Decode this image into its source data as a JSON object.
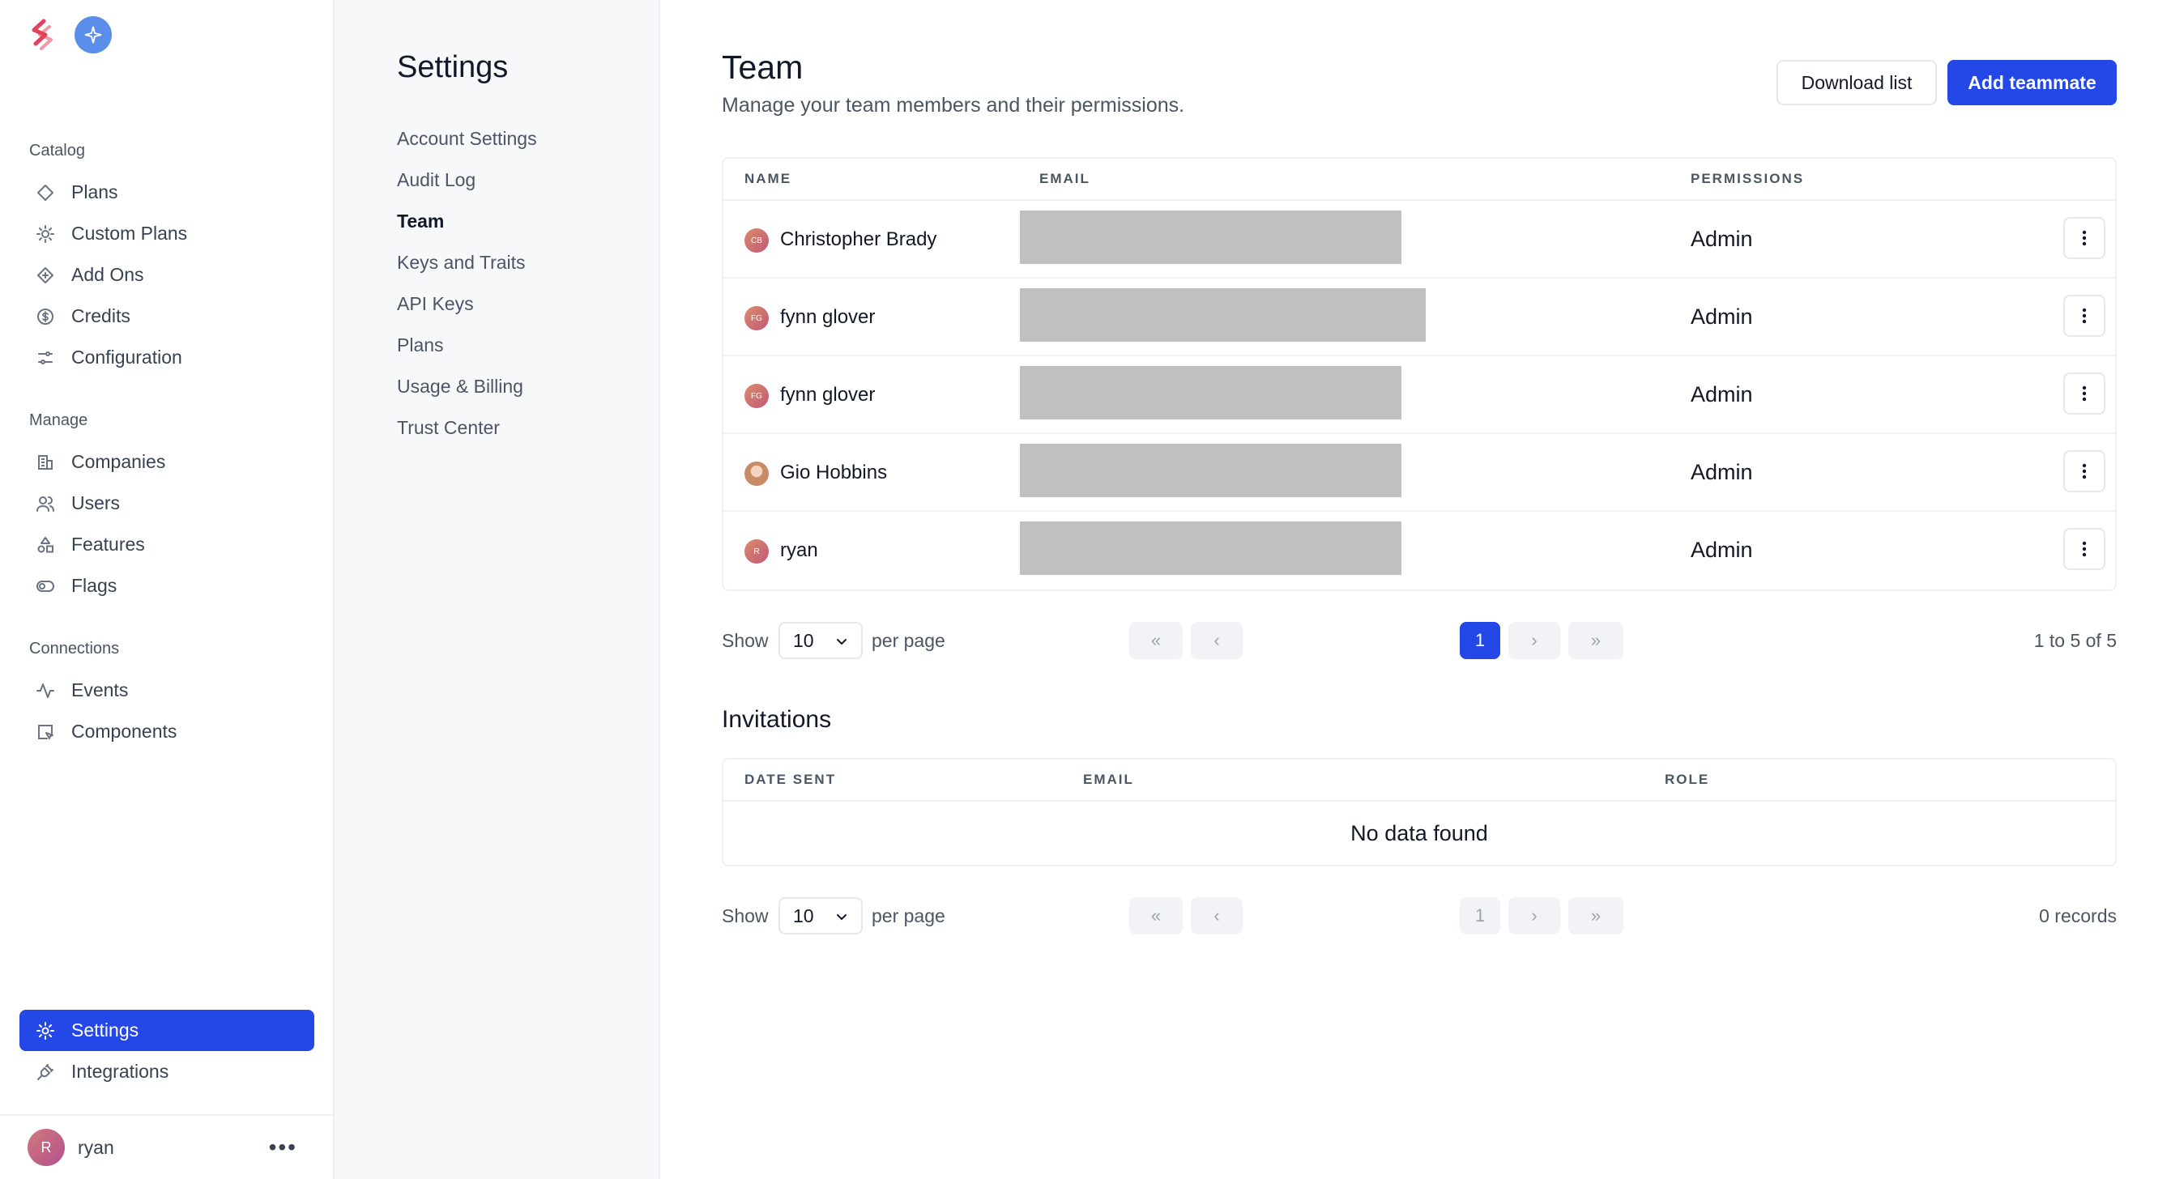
{
  "nav": {
    "sections": [
      {
        "title": "Catalog",
        "items": [
          {
            "label": "Plans",
            "icon": "diamond-icon"
          },
          {
            "label": "Custom Plans",
            "icon": "gear-star-icon"
          },
          {
            "label": "Add Ons",
            "icon": "diamond-plus-icon"
          },
          {
            "label": "Credits",
            "icon": "dollar-circle-icon"
          },
          {
            "label": "Configuration",
            "icon": "sliders-icon"
          }
        ]
      },
      {
        "title": "Manage",
        "items": [
          {
            "label": "Companies",
            "icon": "building-icon"
          },
          {
            "label": "Users",
            "icon": "users-icon"
          },
          {
            "label": "Features",
            "icon": "shapes-icon"
          },
          {
            "label": "Flags",
            "icon": "toggle-icon"
          }
        ]
      },
      {
        "title": "Connections",
        "items": [
          {
            "label": "Events",
            "icon": "activity-icon"
          },
          {
            "label": "Components",
            "icon": "component-icon"
          }
        ]
      }
    ],
    "bottom": [
      {
        "label": "Settings",
        "icon": "gear-icon",
        "active": true
      },
      {
        "label": "Integrations",
        "icon": "plug-icon"
      }
    ],
    "user": {
      "initial": "R",
      "name": "ryan",
      "more": "•••"
    }
  },
  "settings": {
    "title": "Settings",
    "links": [
      "Account Settings",
      "Audit Log",
      "Team",
      "Keys and Traits",
      "API Keys",
      "Plans",
      "Usage & Billing",
      "Trust Center"
    ],
    "active": "Team"
  },
  "team": {
    "title": "Team",
    "subtitle": "Manage your team members and their permissions.",
    "download_label": "Download list",
    "add_label": "Add teammate",
    "columns": {
      "name": "NAME",
      "email": "EMAIL",
      "permissions": "PERMISSIONS"
    },
    "rows": [
      {
        "initials": "CB",
        "name": "Christopher Brady",
        "permission": "Admin"
      },
      {
        "initials": "FG",
        "name": "fynn glover",
        "permission": "Admin"
      },
      {
        "initials": "FG",
        "name": "fynn glover",
        "permission": "Admin"
      },
      {
        "initials": "",
        "name": "Gio Hobbins",
        "permission": "Admin"
      },
      {
        "initials": "R",
        "name": "ryan",
        "permission": "Admin"
      }
    ],
    "pager": {
      "show": "Show",
      "per_page_value": "10",
      "per_page": "per page",
      "current_page": "1",
      "summary": "1 to 5 of 5"
    }
  },
  "invitations": {
    "title": "Invitations",
    "columns": {
      "date_sent": "DATE SENT",
      "email": "EMAIL",
      "role": "ROLE"
    },
    "empty": "No data found",
    "pager": {
      "show": "Show",
      "per_page_value": "10",
      "per_page": "per page",
      "current_page": "1",
      "summary": "0 records"
    }
  },
  "colors": {
    "accent": "#2447e8",
    "redacted": "#c0c0c0"
  }
}
